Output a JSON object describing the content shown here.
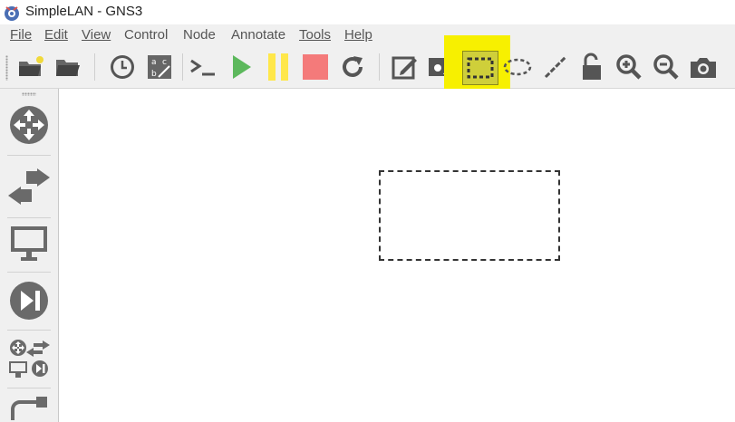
{
  "window": {
    "title": "SimpleLAN - GNS3"
  },
  "menu": [
    {
      "label": "File"
    },
    {
      "label": "Edit"
    },
    {
      "label": "View"
    },
    {
      "label": "Control"
    },
    {
      "label": "Node"
    },
    {
      "label": "Annotate"
    },
    {
      "label": "Tools"
    },
    {
      "label": "Help"
    }
  ],
  "toolbar": {
    "buttons": [
      "new-project",
      "open-project",
      "history-snapshot",
      "show-interface-labels",
      "console-all",
      "start-all",
      "suspend-all",
      "stop-all",
      "reload-all",
      "add-note",
      "insert-image",
      "draw-rectangle",
      "draw-ellipse",
      "draw-line",
      "lock-items",
      "zoom-in",
      "zoom-out",
      "screenshot"
    ],
    "active": "draw-rectangle",
    "colors": {
      "start": "#5cb85c",
      "suspend": "#ffe74a",
      "stop": "#f47a7a",
      "icon": "#555555",
      "highlight": "#f7f000"
    }
  },
  "sidebar": {
    "categories": [
      "routers",
      "switches",
      "end-devices",
      "security-devices",
      "all-devices",
      "add-link"
    ]
  },
  "canvas": {
    "items": [
      {
        "type": "rectangle-annotation",
        "border": "dashed",
        "color": "#333333"
      }
    ]
  }
}
